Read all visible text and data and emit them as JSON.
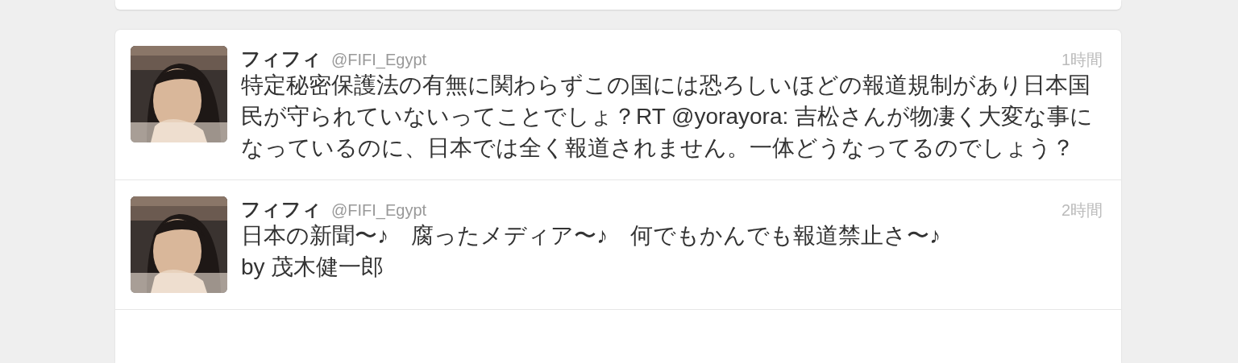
{
  "tweets": [
    {
      "name": "フィフィ",
      "handle": "@FIFI_Egypt",
      "time": "1時間",
      "text": "特定秘密保護法の有無に関わらずこの国には恐ろしいほどの報道規制があり日本国民が守られていないってことでしょ？RT @yorayora: 吉松さんが物凄く大変な事になっているのに、日本では全く報道されません。一体どうなってるのでしょう？"
    },
    {
      "name": "フィフィ",
      "handle": "@FIFI_Egypt",
      "time": "2時間",
      "text": "日本の新聞〜♪　腐ったメディア〜♪　何でもかんでも報道禁止さ〜♪\nby 茂木健一郎"
    }
  ]
}
